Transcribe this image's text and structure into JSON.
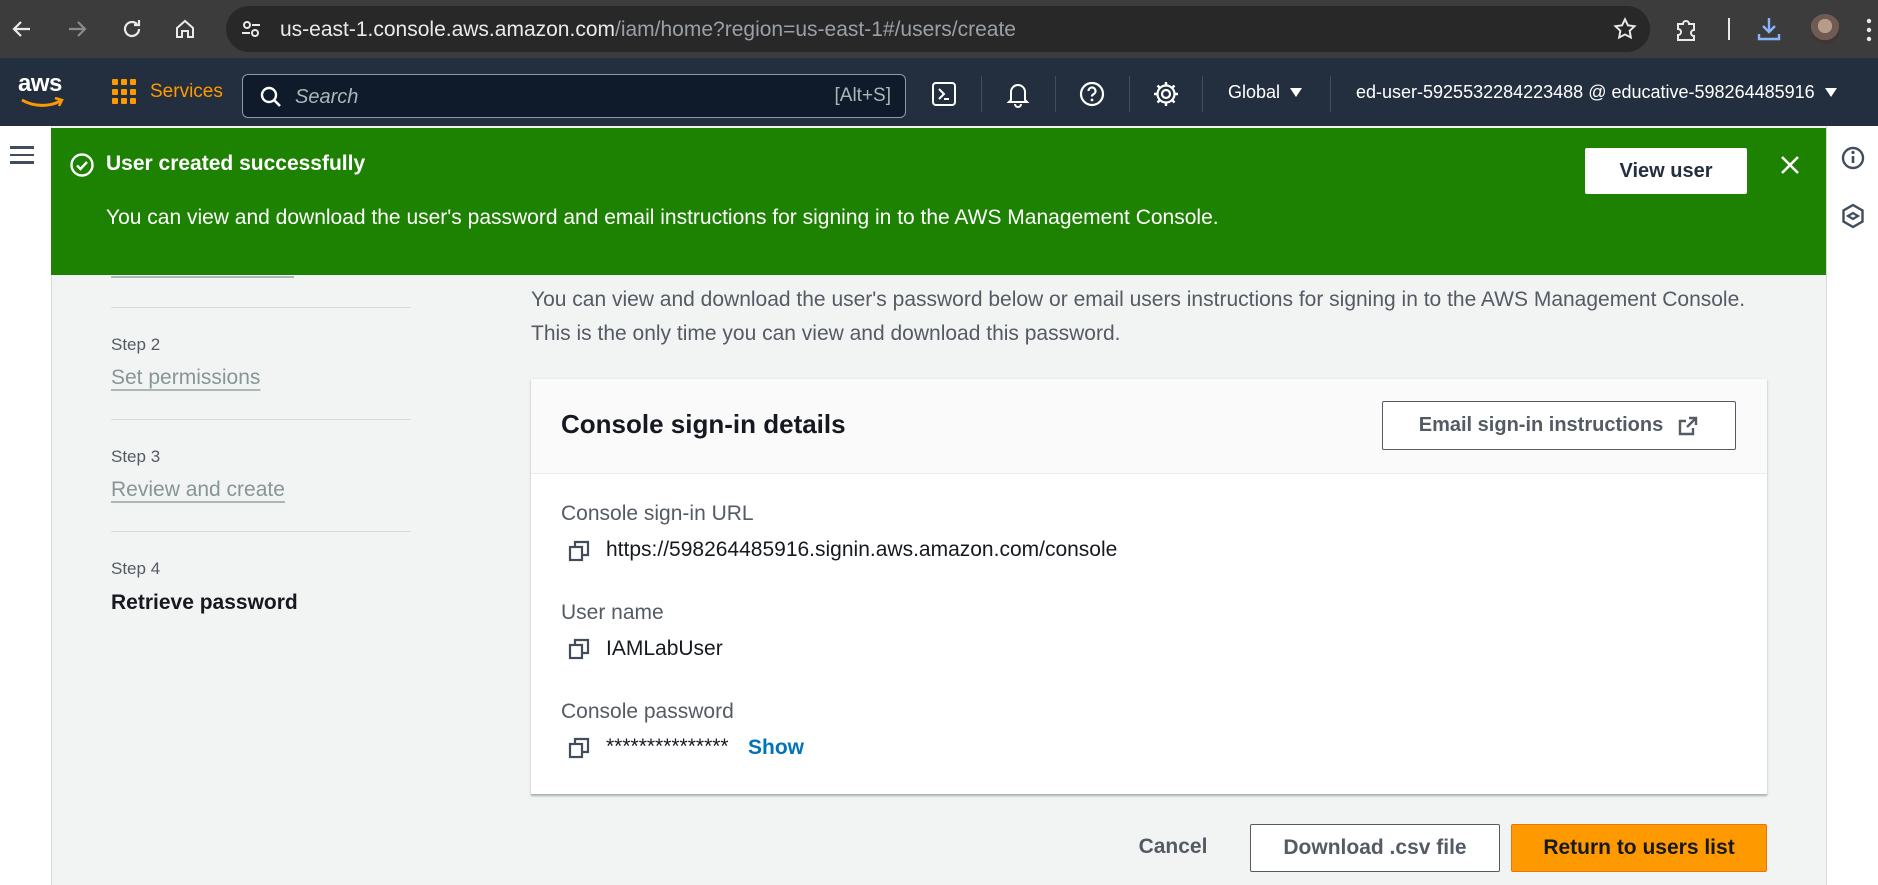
{
  "browser": {
    "url_host": "us-east-1.console.aws.amazon.com",
    "url_path": "/iam/home?region=us-east-1#/users/create"
  },
  "aws_nav": {
    "logo_text": "aws",
    "services_label": "Services",
    "search_placeholder": "Search",
    "search_shortcut": "[Alt+S]",
    "region_label": "Global",
    "account_label": "ed-user-5925532284223488 @ educative-598264485916"
  },
  "flash": {
    "title": "User created successfully",
    "body": "You can view and download the user's password and email instructions for signing in to the AWS Management Console.",
    "view_user_label": "View user",
    "color": "#1d8102"
  },
  "steps": [
    {
      "step": "Step 2",
      "label": "Set permissions",
      "state": "link"
    },
    {
      "step": "Step 3",
      "label": "Review and create",
      "state": "link"
    },
    {
      "step": "Step 4",
      "label": "Retrieve password",
      "state": "current"
    }
  ],
  "main": {
    "intro_line1": "You can view and download the user's password below or email users instructions for signing in to the AWS Management Console.",
    "intro_line2": "This is the only time you can view and download this password."
  },
  "card": {
    "title": "Console sign-in details",
    "email_button_label": "Email sign-in instructions",
    "fields": {
      "signin_url_label": "Console sign-in URL",
      "signin_url_value": "https://598264485916.signin.aws.amazon.com/console",
      "username_label": "User name",
      "username_value": "IAMLabUser",
      "password_label": "Console password",
      "password_value": "***************",
      "show_label": "Show"
    }
  },
  "footer": {
    "cancel_label": "Cancel",
    "download_label": "Download .csv file",
    "return_label": "Return to users list",
    "primary_color": "#ff9900"
  }
}
